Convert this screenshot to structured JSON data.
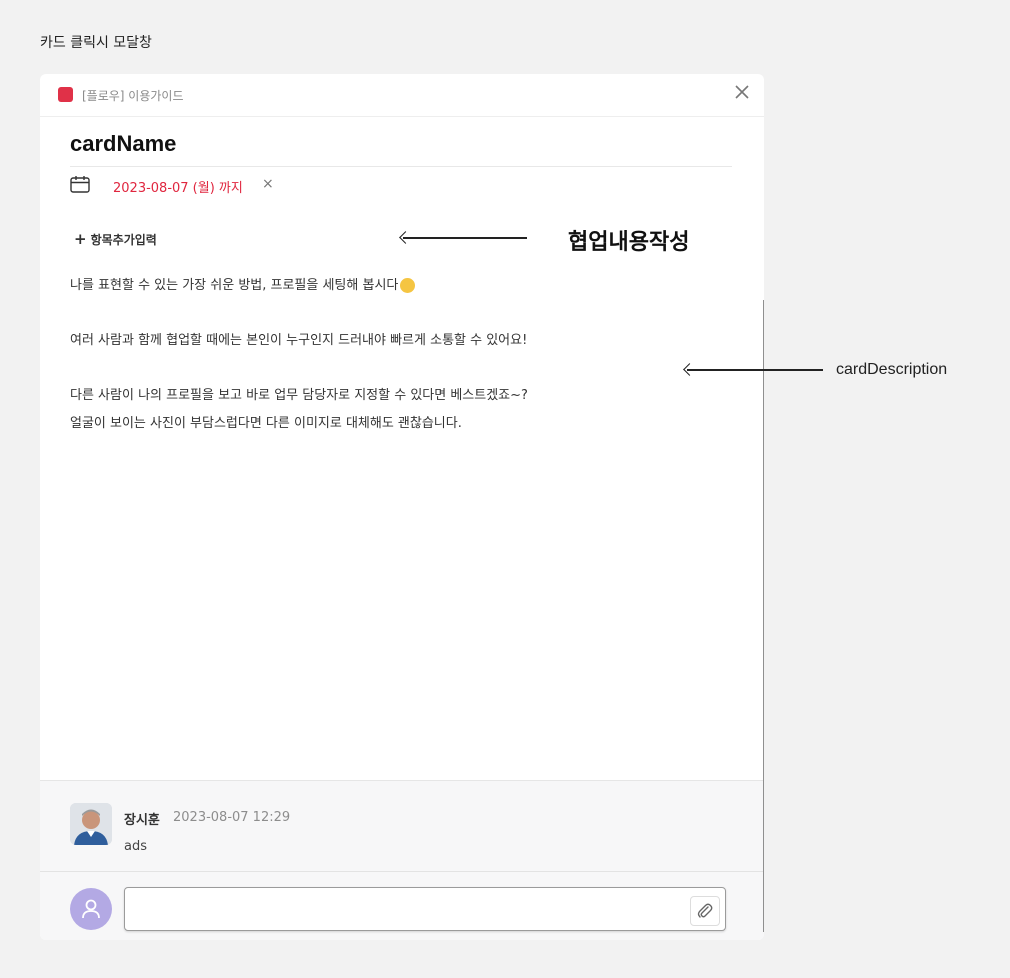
{
  "frame_title": "카드 클릭시 모달창",
  "modal": {
    "project": {
      "name": "[플로우] 이용가이드",
      "color": "#e03148"
    },
    "card_name": "cardName",
    "due": {
      "text": "2023-08-07 (월) 까지",
      "clear": "×",
      "color": "#e0263f"
    },
    "add_item": {
      "plus": "+",
      "label": "항목추가입력"
    },
    "description": [
      "나를 표현할 수 있는 가장 쉬운 방법, 프로필을 세팅해 봅시다",
      "여러 사람과 함께 협업할 때에는 본인이 누구인지 드러내야 빠르게 소통할 수 있어요!",
      "다른 사람이 나의 프로필을 보고 바로 업무 담당자로 지정할 수 있다면 베스트겠죠~?",
      "얼굴이 보이는 사진이 부담스럽다면 다른 이미지로 대체해도 괜찮습니다."
    ],
    "comment": {
      "author": "장시훈",
      "time": "2023-08-07 12:29",
      "text": "ads"
    },
    "comment_input": {
      "value": "",
      "placeholder": ""
    }
  },
  "annotations": {
    "collab": "협업내용작성",
    "description": "cardDescription"
  },
  "icons": [
    "close-icon",
    "calendar-icon",
    "plus-icon",
    "smile-emoji-icon",
    "user-icon",
    "paperclip-icon",
    "arrow-left-icon"
  ]
}
